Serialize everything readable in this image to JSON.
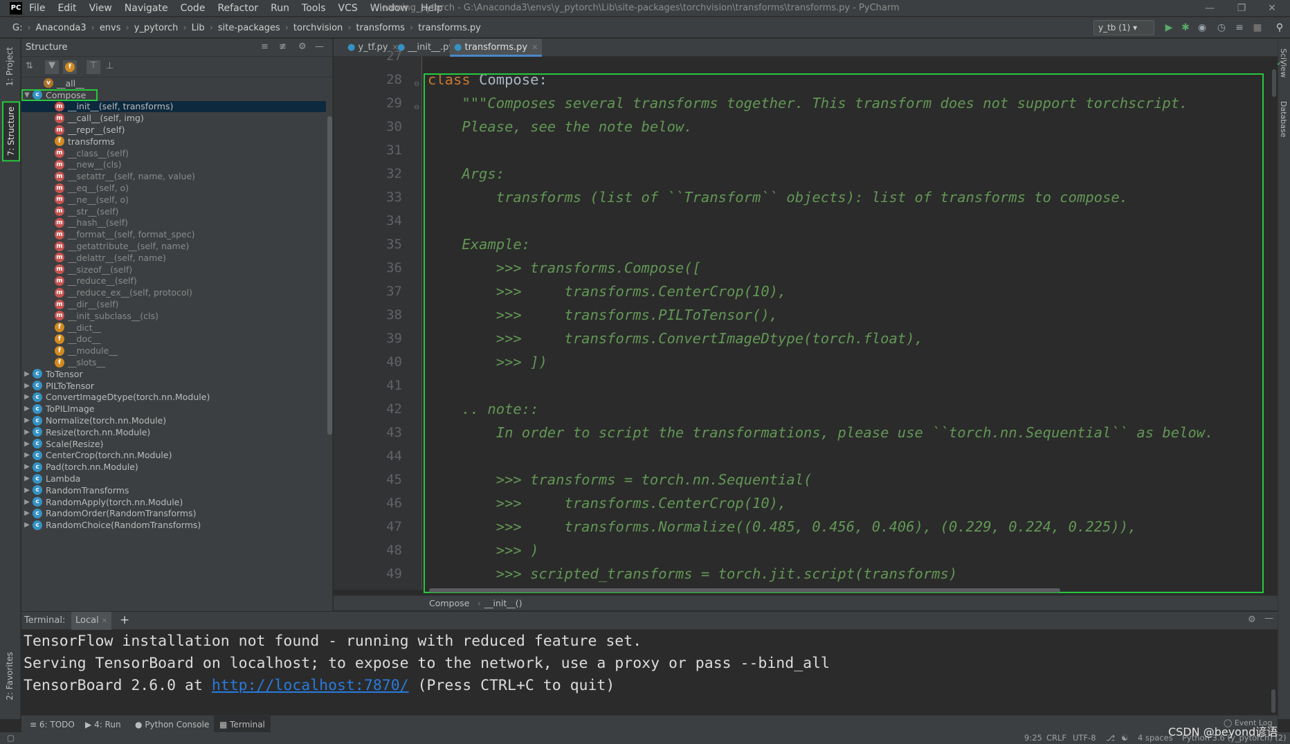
{
  "titlebar": {
    "logo": "PC",
    "menu": [
      "File",
      "Edit",
      "View",
      "Navigate",
      "Code",
      "Refactor",
      "Run",
      "Tools",
      "VCS",
      "Window",
      "Help"
    ],
    "title": "learning_pytorch - G:\\Anaconda3\\envs\\y_pytorch\\Lib\\site-packages\\torchvision\\transforms\\transforms.py - PyCharm"
  },
  "navbar": {
    "crumbs": [
      "G:",
      "Anaconda3",
      "envs",
      "y_pytorch",
      "Lib",
      "site-packages",
      "torchvision",
      "transforms",
      "transforms.py"
    ],
    "run_config": "y_tb (1)"
  },
  "left_stripe": {
    "project": "1: Project",
    "structure": "7: Structure",
    "favorites": "2: Favorites"
  },
  "right_stripe": {
    "sciview": "SciView",
    "database": "Database"
  },
  "structure": {
    "title": "Structure",
    "items": [
      {
        "label": "__all__",
        "icon": "v",
        "indent": 1,
        "dim": false
      },
      {
        "label": "Compose",
        "icon": "c",
        "indent": 0,
        "expanded": true
      },
      {
        "label": "__init__(self, transforms)",
        "icon": "m",
        "indent": 2,
        "selected": true
      },
      {
        "label": "__call__(self, img)",
        "icon": "m",
        "indent": 2
      },
      {
        "label": "__repr__(self)",
        "icon": "m",
        "indent": 2
      },
      {
        "label": "transforms",
        "icon": "f",
        "indent": 2
      },
      {
        "label": "__class__(self)",
        "icon": "m",
        "indent": 2,
        "dim": true
      },
      {
        "label": "__new__(cls)",
        "icon": "m",
        "indent": 2,
        "dim": true
      },
      {
        "label": "__setattr__(self, name, value)",
        "icon": "m",
        "indent": 2,
        "dim": true
      },
      {
        "label": "__eq__(self, o)",
        "icon": "m",
        "indent": 2,
        "dim": true
      },
      {
        "label": "__ne__(self, o)",
        "icon": "m",
        "indent": 2,
        "dim": true
      },
      {
        "label": "__str__(self)",
        "icon": "m",
        "indent": 2,
        "dim": true
      },
      {
        "label": "__hash__(self)",
        "icon": "m",
        "indent": 2,
        "dim": true
      },
      {
        "label": "__format__(self, format_spec)",
        "icon": "m",
        "indent": 2,
        "dim": true
      },
      {
        "label": "__getattribute__(self, name)",
        "icon": "m",
        "indent": 2,
        "dim": true
      },
      {
        "label": "__delattr__(self, name)",
        "icon": "m",
        "indent": 2,
        "dim": true
      },
      {
        "label": "__sizeof__(self)",
        "icon": "m",
        "indent": 2,
        "dim": true
      },
      {
        "label": "__reduce__(self)",
        "icon": "m",
        "indent": 2,
        "dim": true
      },
      {
        "label": "__reduce_ex__(self, protocol)",
        "icon": "m",
        "indent": 2,
        "dim": true
      },
      {
        "label": "__dir__(self)",
        "icon": "m",
        "indent": 2,
        "dim": true
      },
      {
        "label": "__init_subclass__(cls)",
        "icon": "m",
        "indent": 2,
        "dim": true
      },
      {
        "label": "__dict__",
        "icon": "f",
        "indent": 2,
        "dim": true
      },
      {
        "label": "__doc__",
        "icon": "f",
        "indent": 2,
        "dim": true
      },
      {
        "label": "__module__",
        "icon": "f",
        "indent": 2,
        "dim": true
      },
      {
        "label": "__slots__",
        "icon": "f",
        "indent": 2,
        "dim": true
      },
      {
        "label": "ToTensor",
        "icon": "c",
        "indent": 0,
        "collapsed": true
      },
      {
        "label": "PILToTensor",
        "icon": "c",
        "indent": 0,
        "collapsed": true
      },
      {
        "label": "ConvertImageDtype(torch.nn.Module)",
        "icon": "c",
        "indent": 0,
        "collapsed": true
      },
      {
        "label": "ToPILImage",
        "icon": "c",
        "indent": 0,
        "collapsed": true
      },
      {
        "label": "Normalize(torch.nn.Module)",
        "icon": "c",
        "indent": 0,
        "collapsed": true
      },
      {
        "label": "Resize(torch.nn.Module)",
        "icon": "c",
        "indent": 0,
        "collapsed": true
      },
      {
        "label": "Scale(Resize)",
        "icon": "c",
        "indent": 0,
        "collapsed": true
      },
      {
        "label": "CenterCrop(torch.nn.Module)",
        "icon": "c",
        "indent": 0,
        "collapsed": true
      },
      {
        "label": "Pad(torch.nn.Module)",
        "icon": "c",
        "indent": 0,
        "collapsed": true
      },
      {
        "label": "Lambda",
        "icon": "c",
        "indent": 0,
        "collapsed": true
      },
      {
        "label": "RandomTransforms",
        "icon": "c",
        "indent": 0,
        "collapsed": true
      },
      {
        "label": "RandomApply(torch.nn.Module)",
        "icon": "c",
        "indent": 0,
        "collapsed": true
      },
      {
        "label": "RandomOrder(RandomTransforms)",
        "icon": "c",
        "indent": 0,
        "collapsed": true
      },
      {
        "label": "RandomChoice(RandomTransforms)",
        "icon": "c",
        "indent": 0,
        "collapsed": true
      }
    ]
  },
  "editor": {
    "tabs": [
      {
        "label": "y_tf.py",
        "active": false
      },
      {
        "label": "__init__.py",
        "active": false
      },
      {
        "label": "transforms.py",
        "active": true
      }
    ],
    "line_numbers": [
      "27",
      "28",
      "29",
      "30",
      "31",
      "32",
      "33",
      "34",
      "35",
      "36",
      "37",
      "38",
      "39",
      "40",
      "41",
      "42",
      "43",
      "44",
      "45",
      "46",
      "47",
      "48",
      "49"
    ],
    "lines": [
      "",
      "class Compose:",
      "    \"\"\"Composes several transforms together. This transform does not support torchscript.",
      "    Please, see the note below.",
      "",
      "    Args:",
      "        transforms (list of ``Transform`` objects): list of transforms to compose.",
      "",
      "    Example:",
      "        >>> transforms.Compose([",
      "        >>>     transforms.CenterCrop(10),",
      "        >>>     transforms.PILToTensor(),",
      "        >>>     transforms.ConvertImageDtype(torch.float),",
      "        >>> ])",
      "",
      "    .. note::",
      "        In order to script the transformations, please use ``torch.nn.Sequential`` as below.",
      "",
      "        >>> transforms = torch.nn.Sequential(",
      "        >>>     transforms.CenterCrop(10),",
      "        >>>     transforms.Normalize((0.485, 0.456, 0.406), (0.229, 0.224, 0.225)),",
      "        >>> )",
      "        >>> scripted_transforms = torch.jit.script(transforms)"
    ],
    "crumbs": [
      "Compose",
      "__init__()"
    ]
  },
  "terminal": {
    "label": "Terminal:",
    "tab": "Local",
    "lines": [
      "TensorFlow installation not found - running with reduced feature set.",
      "Serving TensorBoard on localhost; to expose to the network, use a proxy or pass --bind_all"
    ],
    "line3_prefix": "TensorBoard 2.6.0 at ",
    "line3_link": "http://localhost:7870/",
    "line3_suffix": " (Press CTRL+C to quit)"
  },
  "bottom_tools": [
    "6: TODO",
    "4: Run",
    "Python Console",
    "Terminal"
  ],
  "status": {
    "position": "9:25",
    "line_sep": "CRLF",
    "encoding": "UTF-8",
    "indent": "4 spaces",
    "interpreter": "Python 3.6 (y_pytorch) (2)",
    "event_log": "Event Log"
  },
  "watermark": "CSDN @beyond谚语",
  "colors": {
    "highlight": "#27c93f",
    "keyword": "#cc7832",
    "docstring": "#629755",
    "selection": "#0d293e",
    "link": "#287bde"
  }
}
